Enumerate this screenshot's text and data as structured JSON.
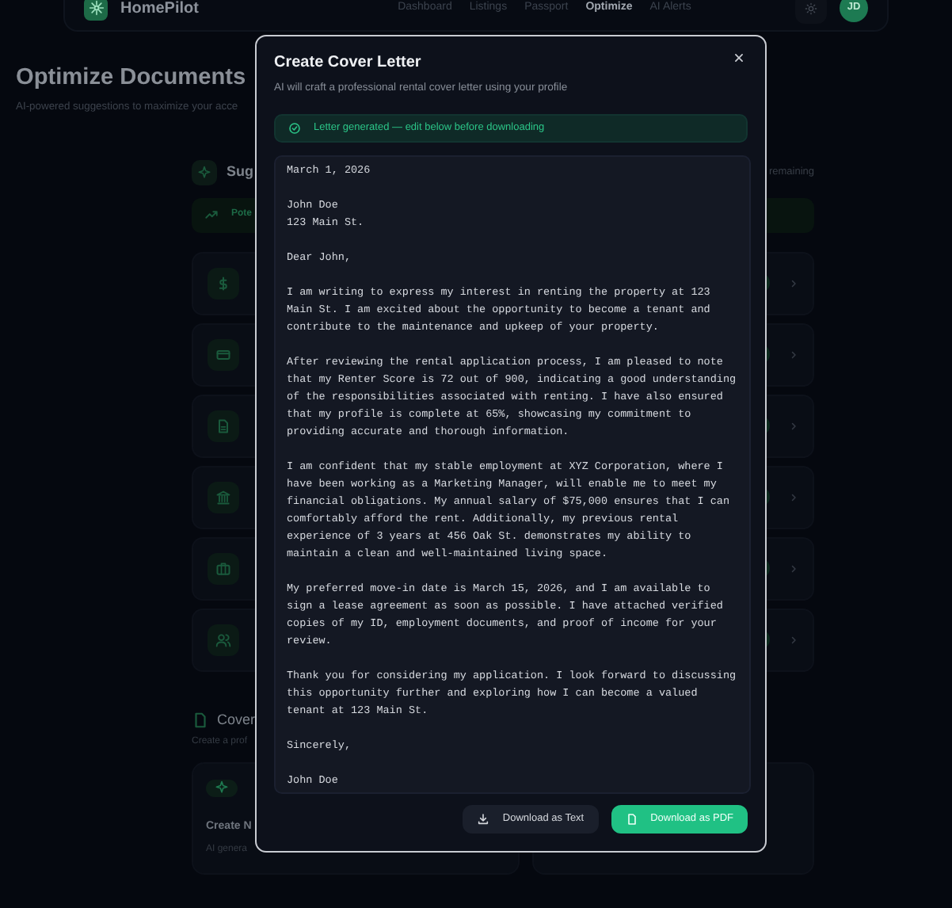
{
  "navbar": {
    "brand": "HomePilot",
    "links": [
      {
        "label": "Dashboard",
        "selected": false
      },
      {
        "label": "Listings",
        "selected": false
      },
      {
        "label": "Passport",
        "selected": false
      },
      {
        "label": "Optimize",
        "selected": true
      },
      {
        "label": "AI Alerts",
        "selected": false
      }
    ],
    "avatar": "JD"
  },
  "page": {
    "title": "Optimize Documents",
    "subtitle": "AI-powered suggestions to maximize your acce"
  },
  "suggestions": {
    "title": "Sug",
    "remaining": "remaining",
    "potential": "Pote",
    "cards": [
      {
        "kind": "dollar"
      },
      {
        "kind": "card"
      },
      {
        "kind": "document"
      },
      {
        "kind": "bank"
      },
      {
        "kind": "briefcase"
      },
      {
        "kind": "people"
      }
    ]
  },
  "cover": {
    "title": "Cover",
    "subtitle": "Create a prof",
    "card": {
      "title": "Create N",
      "text": "AI genera"
    }
  },
  "modal": {
    "title": "Create Cover Letter",
    "subtitle": "AI will craft a professional rental cover letter using your profile",
    "status": "Letter generated — edit below before downloading",
    "letter": "March 1, 2026\n\nJohn Doe\n123 Main St.\n\nDear John,\n\nI am writing to express my interest in renting the property at 123 Main St. I am excited about the opportunity to become a tenant and contribute to the maintenance and upkeep of your property.\n\nAfter reviewing the rental application process, I am pleased to note that my Renter Score is 72 out of 900, indicating a good understanding of the responsibilities associated with renting. I have also ensured that my profile is complete at 65%, showcasing my commitment to providing accurate and thorough information.\n\nI am confident that my stable employment at XYZ Corporation, where I have been working as a Marketing Manager, will enable me to meet my financial obligations. My annual salary of $75,000 ensures that I can comfortably afford the rent. Additionally, my previous rental experience of 3 years at 456 Oak St. demonstrates my ability to maintain a clean and well-maintained living space.\n\nMy preferred move-in date is March 15, 2026, and I am available to sign a lease agreement as soon as possible. I have attached verified copies of my ID, employment documents, and proof of income for your review.\n\nThank you for considering my application. I look forward to discussing this opportunity further and exploring how I can become a valued tenant at 123 Main St.\n\nSincerely,\n\nJohn Doe",
    "buttons": [
      {
        "label": "Download as Text",
        "kind": "secondary"
      },
      {
        "label": "Download as PDF",
        "kind": "primary"
      }
    ]
  }
}
